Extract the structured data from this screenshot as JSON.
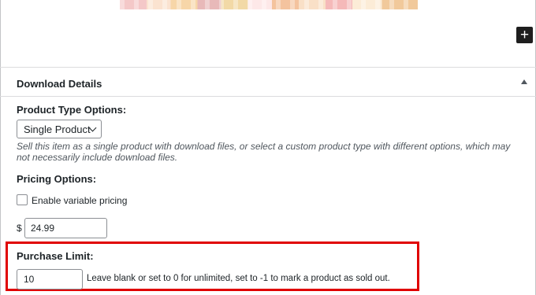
{
  "toolbar": {
    "add_block_symbol": "+"
  },
  "panel": {
    "title": "Download Details",
    "product_type": {
      "label": "Product Type Options:",
      "selected": "Single Product",
      "description": "Sell this item as a single product with download files, or select a custom product type with different options, which may not necessarily include download files."
    },
    "pricing": {
      "label": "Pricing Options:",
      "variable_pricing_label": "Enable variable pricing",
      "variable_pricing_checked": false,
      "currency_symbol": "$",
      "price": "24.99"
    },
    "purchase_limit": {
      "label": "Purchase Limit:",
      "value": "10",
      "help": "Leave blank or set to 0 for unlimited, set to -1 to mark a product as sold out."
    }
  },
  "colors": {
    "highlight": "#e00000",
    "text": "#1d2327",
    "muted": "#50575e",
    "button_bg": "#1e1e1e"
  }
}
